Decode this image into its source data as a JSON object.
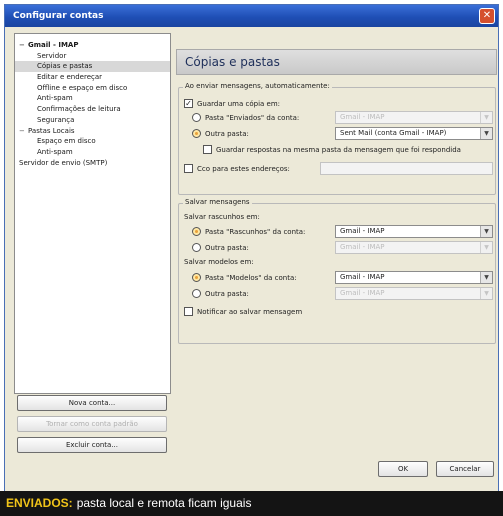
{
  "window": {
    "title": "Configurar contas",
    "close_glyph": "✕"
  },
  "tree": {
    "items": [
      {
        "label": "Gmail - IMAP",
        "expander": "−"
      },
      {
        "label": "Servidor"
      },
      {
        "label": "Cópias e pastas"
      },
      {
        "label": "Editar e endereçar"
      },
      {
        "label": "Offline e espaço em disco"
      },
      {
        "label": "Anti-spam"
      },
      {
        "label": "Confirmações de leitura"
      },
      {
        "label": "Segurança"
      },
      {
        "label": "Pastas Locais",
        "expander": "−"
      },
      {
        "label": "Espaço em disco"
      },
      {
        "label": "Anti-spam"
      },
      {
        "label": "Servidor de envio (SMTP)"
      }
    ]
  },
  "left_buttons": {
    "new_account": "Nova conta...",
    "set_default": "Tornar como conta padrão",
    "remove_account": "Excluir conta..."
  },
  "panel": {
    "header": "Cópias e pastas",
    "on_send": {
      "title": "Ao enviar mensagens, automaticamente:",
      "save_copy": "Guardar uma cópia em:",
      "sent_folder_radio": "Pasta \"Enviados\" da conta:",
      "sent_folder_value": "Gmail - IMAP",
      "other_folder_radio": "Outra pasta:",
      "other_folder_value": "Sent Mail (conta Gmail - IMAP)",
      "replies_same_folder": "Guardar respostas na mesma pasta da mensagem que foi respondida",
      "cc_label": "Cco para estes endereços:",
      "cc_value": ""
    },
    "save_messages": {
      "title": "Salvar mensagens",
      "drafts_label": "Salvar rascunhos em:",
      "drafts_radio": "Pasta \"Rascunhos\" da conta:",
      "drafts_value": "Gmail - IMAP",
      "drafts_other_radio": "Outra pasta:",
      "drafts_other_value": "Gmail - IMAP",
      "templates_label": "Salvar modelos em:",
      "templates_radio": "Pasta \"Modelos\" da conta:",
      "templates_value": "Gmail - IMAP",
      "templates_other_radio": "Outra pasta:",
      "templates_other_value": "Gmail - IMAP",
      "notify_label": "Notificar ao salvar mensagem"
    }
  },
  "dialog_buttons": {
    "ok": "OK",
    "cancel": "Cancelar"
  },
  "caption": {
    "lead": "ENVIADOS:",
    "text": "pasta local e remota ficam iguais"
  }
}
